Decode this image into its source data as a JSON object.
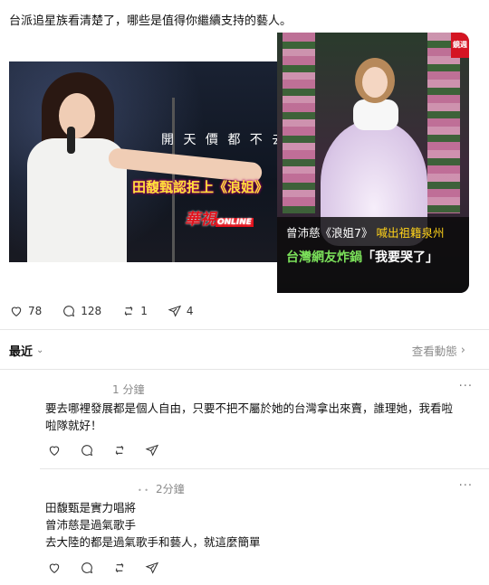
{
  "post": {
    "text": "台派追星族看清楚了，哪些是值得你繼續支持的藝人。"
  },
  "media": {
    "left_image": {
      "caption_top": "開 天 價 都 不 去",
      "caption_main": "田馥甄認拒上《浪姐》",
      "logo_text": "華視",
      "logo_sub": "ONLINE"
    },
    "right_image": {
      "logo_text": "鏡週",
      "caption_line1_name": "曾沛慈《浪姐7》",
      "caption_line1_hl": "喊出祖籍泉州",
      "caption_line2_green": "台灣網友炸鍋",
      "caption_line2_white": "「我要哭了」"
    }
  },
  "actions": {
    "likes": "78",
    "comments": "128",
    "reposts": "1",
    "shares": "4"
  },
  "sort_bar": {
    "label": "最近",
    "view_activity": "查看動態"
  },
  "replies": [
    {
      "time": "1 分鐘",
      "text_line1": "要去哪裡發展都是個人自由，只要不把不屬於她的台灣拿出來賣，誰理她，我看啦",
      "text_line2": "啦隊就好！"
    },
    {
      "time": "2分鐘",
      "line1": "田馥甄是實力唱將",
      "line2": "曾沛慈是過氣歌手",
      "line3": "去大陸的都是過氣歌手和藝人，就這麼簡單"
    }
  ],
  "icons": [
    "heart-icon",
    "comment-icon",
    "repost-icon",
    "share-icon",
    "more-icon",
    "chevron-down-icon",
    "chevron-right-icon"
  ]
}
